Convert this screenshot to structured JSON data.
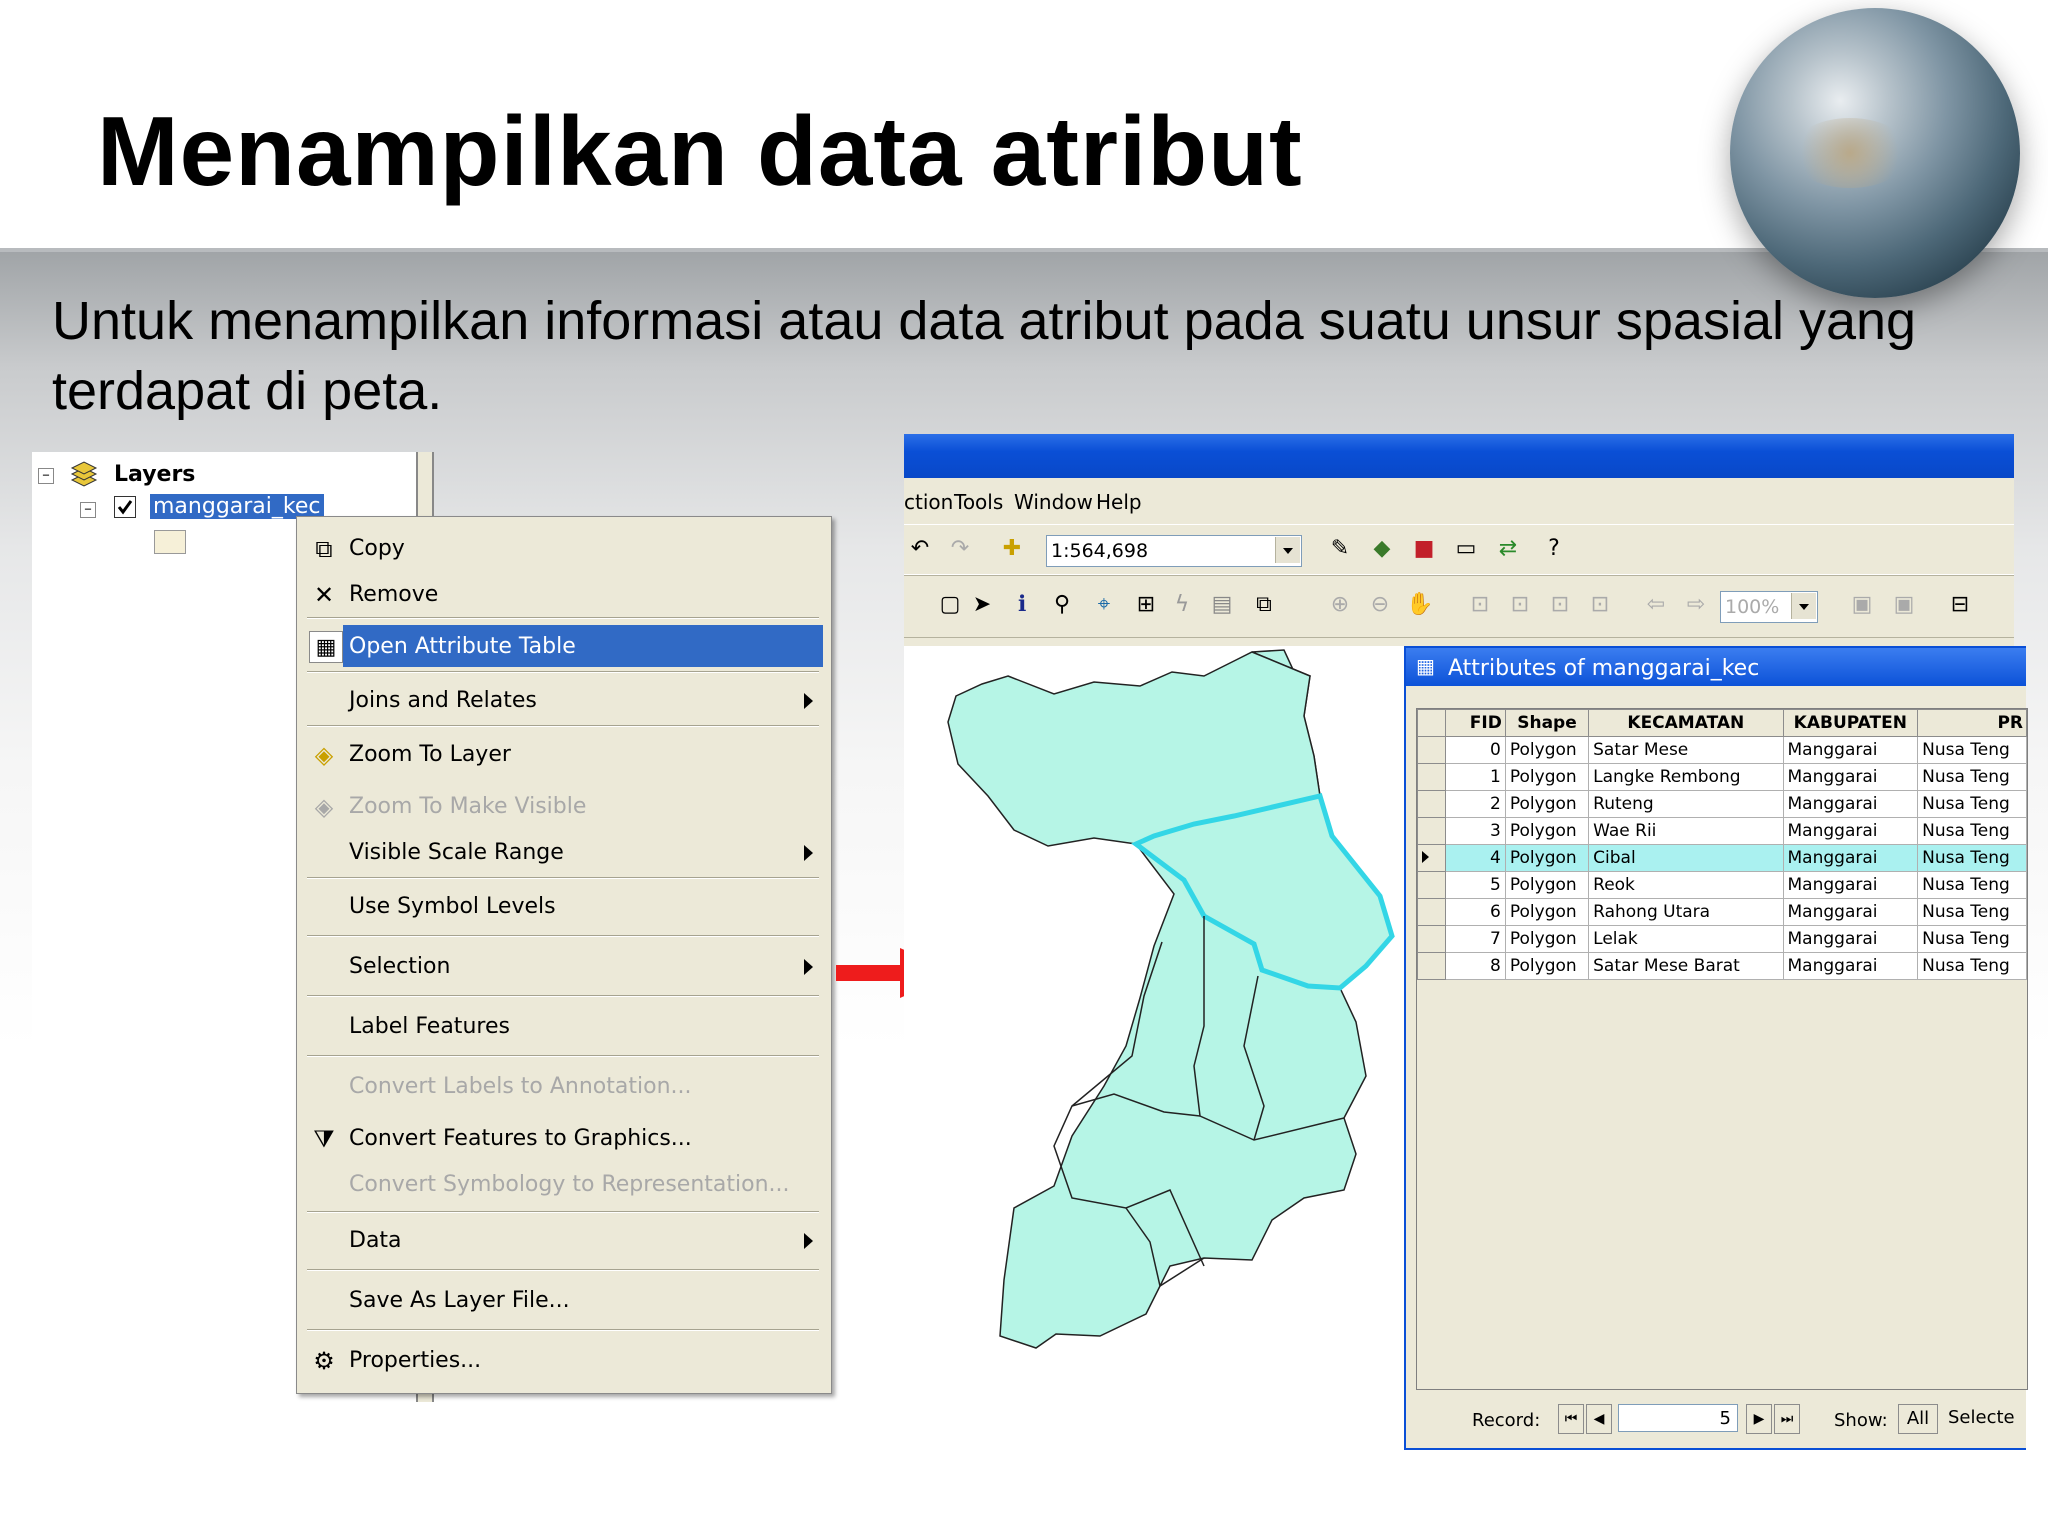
{
  "slide": {
    "title": "Menampilkan data atribut",
    "subtitle": "Untuk menampilkan informasi atau data atribut pada suatu unsur spasial yang terdapat di peta."
  },
  "toc": {
    "root_label": "Layers",
    "layer_label": "manggarai_kec",
    "layer_checked": true
  },
  "context_menu": {
    "items": [
      {
        "label": "Copy",
        "icon": "copy-icon",
        "enabled": true
      },
      {
        "label": "Remove",
        "icon": "remove-icon",
        "enabled": true
      },
      {
        "label": "Open Attribute Table",
        "icon": "table-icon",
        "enabled": true,
        "highlighted": true
      },
      {
        "label": "Joins and Relates",
        "submenu": true,
        "enabled": true
      },
      {
        "label": "Zoom To Layer",
        "icon": "zoom-to-layer-icon",
        "enabled": true
      },
      {
        "label": "Zoom To Make Visible",
        "icon": "zoom-visible-icon",
        "enabled": false
      },
      {
        "label": "Visible Scale Range",
        "submenu": true,
        "enabled": true
      },
      {
        "label": "Use Symbol Levels",
        "enabled": true
      },
      {
        "label": "Selection",
        "submenu": true,
        "enabled": true
      },
      {
        "label": "Label Features",
        "enabled": true
      },
      {
        "label": "Convert Labels to Annotation...",
        "enabled": false
      },
      {
        "label": "Convert Features to Graphics...",
        "icon": "convert-graphics-icon",
        "enabled": true
      },
      {
        "label": "Convert Symbology to Representation...",
        "enabled": false
      },
      {
        "label": "Data",
        "submenu": true,
        "enabled": true
      },
      {
        "label": "Save As Layer File...",
        "enabled": true
      },
      {
        "label": "Properties...",
        "icon": "properties-icon",
        "enabled": true
      }
    ]
  },
  "arcmap": {
    "menu": [
      "ction",
      "Tools",
      "Window",
      "Help"
    ],
    "scale": "1:564,698",
    "zoom_percent": "100%"
  },
  "attributes": {
    "title": "Attributes of manggarai_kec",
    "columns": [
      "FID",
      "Shape",
      "KECAMATAN",
      "KABUPATEN",
      "PR"
    ],
    "rows": [
      [
        "0",
        "Polygon",
        "Satar Mese",
        "Manggarai",
        "Nusa Teng"
      ],
      [
        "1",
        "Polygon",
        "Langke Rembong",
        "Manggarai",
        "Nusa Teng"
      ],
      [
        "2",
        "Polygon",
        "Ruteng",
        "Manggarai",
        "Nusa Teng"
      ],
      [
        "3",
        "Polygon",
        "Wae Rii",
        "Manggarai",
        "Nusa Teng"
      ],
      [
        "4",
        "Polygon",
        "Cibal",
        "Manggarai",
        "Nusa Teng"
      ],
      [
        "5",
        "Polygon",
        "Reok",
        "Manggarai",
        "Nusa Teng"
      ],
      [
        "6",
        "Polygon",
        "Rahong Utara",
        "Manggarai",
        "Nusa Teng"
      ],
      [
        "7",
        "Polygon",
        "Lelak",
        "Manggarai",
        "Nusa Teng"
      ],
      [
        "8",
        "Polygon",
        "Satar Mese Barat",
        "Manggarai",
        "Nusa Teng"
      ]
    ],
    "current_row_index": 4,
    "record_label": "Record:",
    "record_value": "5",
    "show_label": "Show:",
    "show_all_label": "All",
    "show_selected_label": "Selecte"
  },
  "colors": {
    "map_fill": "#b6f5e6",
    "selection_outline": "#33d6e6",
    "menu_highlight": "#316ac5",
    "arrow": "#ee1c1c"
  }
}
